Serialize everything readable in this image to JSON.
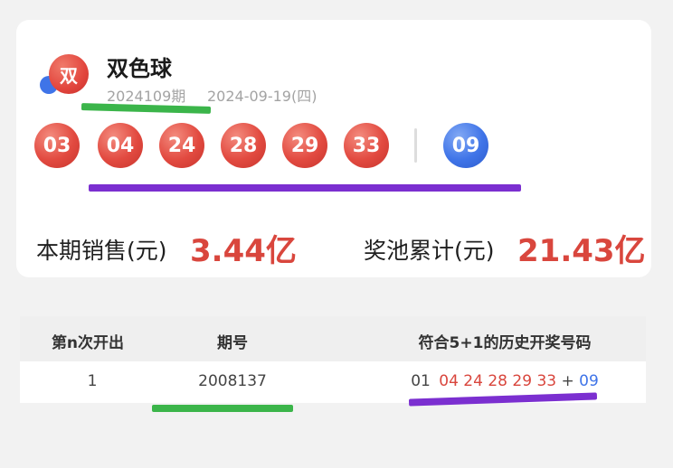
{
  "header": {
    "logo_char": "双",
    "title": "双色球",
    "issue": "2024109期",
    "date": "2024-09-19(四)"
  },
  "draw": {
    "red_balls": [
      "03",
      "04",
      "24",
      "28",
      "29",
      "33"
    ],
    "blue_ball": "09"
  },
  "stats": {
    "sales_label": "本期销售(元)",
    "sales_value": "3.44亿",
    "pool_label": "奖池累计(元)",
    "pool_value": "21.43亿"
  },
  "table": {
    "headers": [
      "第n次开出",
      "期号",
      "符合5+1的历史开奖号码"
    ],
    "row": {
      "index": "1",
      "issue": "2008137",
      "first_num": "01",
      "red_nums": [
        "04",
        "24",
        "28",
        "29",
        "33"
      ],
      "plus": "+",
      "blue_num": "09"
    }
  },
  "colors": {
    "red_ball": "#e24a40",
    "blue_ball": "#3f74e8",
    "highlight_green": "#3bb54a",
    "highlight_purple": "#7b2fd0",
    "value_red": "#d9463d"
  }
}
